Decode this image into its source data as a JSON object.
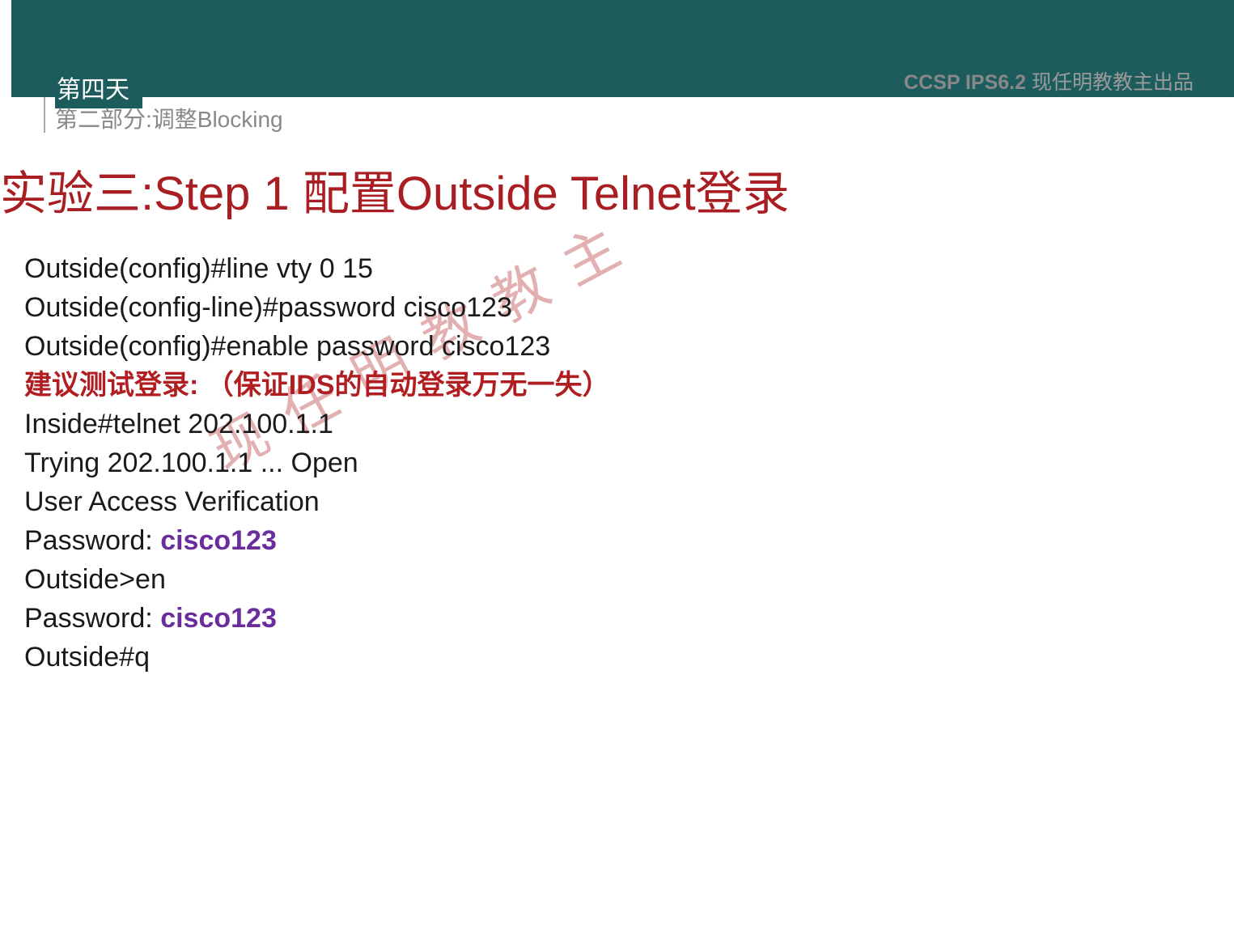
{
  "header": {
    "day": "第四天",
    "subtitle": "第二部分:调整Blocking",
    "right_bold": "CCSP IPS6.2",
    "right_text": "  现任明教教主出品"
  },
  "title": "实验三:Step 1 配置Outside Telnet登录",
  "content": {
    "line1": "Outside(config)#line vty 0 15",
    "line2": "Outside(config-line)#password cisco123",
    "line3": "Outside(config)#enable password cisco123",
    "line4": "建议测试登录: （保证IDS的自动登录万无一失）",
    "line5": "Inside#telnet 202.100.1.1",
    "line6": "Trying 202.100.1.1 ... Open",
    "line7": "User Access Verification",
    "line8a": "Password: ",
    "line8b": "cisco123",
    "line9": "Outside>en",
    "line10a": "Password: ",
    "line10b": "cisco123",
    "line11": "Outside#q"
  },
  "watermark": "现任明教教主"
}
